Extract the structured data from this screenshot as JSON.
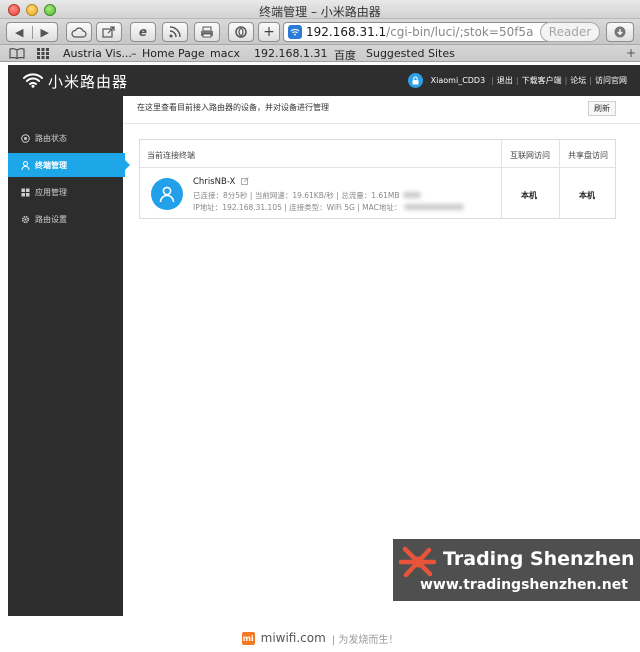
{
  "browser": {
    "window_title": "终端管理 – 小米路由器",
    "url_host": "192.168.31.1",
    "url_path": "/cgi-bin/luci/;stok=50f5a",
    "reader_label": "Reader",
    "bookmarks": [
      "Austria Vis...",
      "Home Page",
      "macx",
      "192.168.1.31",
      "百度",
      "Suggested Sites"
    ]
  },
  "header": {
    "logo_text": "小米路由器",
    "user_name": "Xiaomi_CDD3",
    "links": [
      "退出",
      "下载客户端",
      "论坛",
      "访问官网"
    ]
  },
  "sidebar": {
    "items": [
      {
        "label": "路由状态",
        "icon": "status-icon"
      },
      {
        "label": "终端管理",
        "icon": "user-icon"
      },
      {
        "label": "应用管理",
        "icon": "grid-icon"
      },
      {
        "label": "路由设置",
        "icon": "gear-icon"
      }
    ],
    "active_index": 1,
    "accent_color": "#1da7e8"
  },
  "main": {
    "description": "在这里查看目前接入路由器的设备，并对设备进行管理",
    "refresh_label": "刷新",
    "table": {
      "headers": [
        "当前连接终端",
        "互联网访问",
        "共享盘访问"
      ],
      "rows": [
        {
          "name": "ChrisNB-X",
          "line1": "已连接：8分5秒 | 当前网速：19.61KB/秒 | 总流量：1.61MB",
          "line2": "IP地址：192.168.31.105 | 连接类型：WiFi 5G | MAC地址：",
          "internet": "本机",
          "share": "本机"
        }
      ]
    }
  },
  "watermark": {
    "title": "Trading Shenzhen",
    "url": "www.tradingshenzhen.net"
  },
  "footer": {
    "badge": "mi",
    "site": "miwifi.com",
    "slogan": "| 为发烧而生！"
  }
}
